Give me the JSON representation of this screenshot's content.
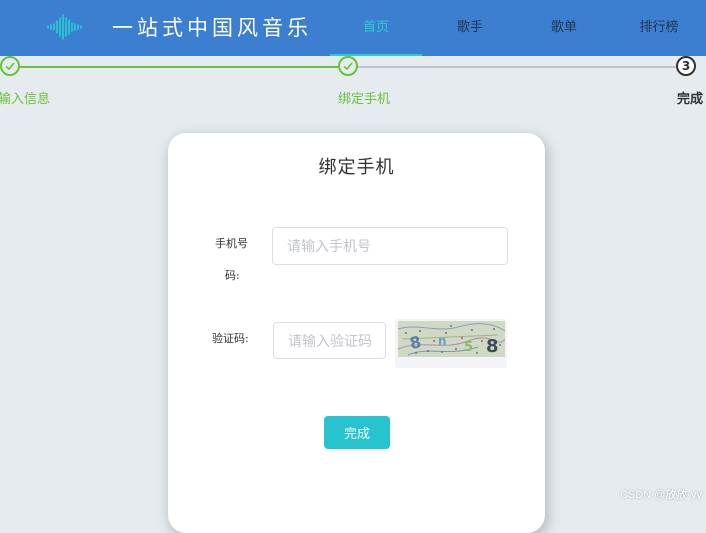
{
  "header": {
    "brand": "一站式中国风音乐",
    "logo_icon": "sound-wave-icon",
    "nav": [
      {
        "label": "首页",
        "active": true
      },
      {
        "label": "歌手",
        "active": false
      },
      {
        "label": "歌单",
        "active": false
      },
      {
        "label": "排行榜",
        "active": false
      }
    ]
  },
  "steps": [
    {
      "label": "输入信息",
      "status": "done"
    },
    {
      "label": "绑定手机",
      "status": "done"
    },
    {
      "label": "完成",
      "status": "current",
      "number": "3"
    }
  ],
  "form": {
    "title": "绑定手机",
    "phone_label_line1": "手机号",
    "phone_label_line2": "码:",
    "phone_placeholder": "请输入手机号",
    "code_label": "验证码:",
    "code_placeholder": "请输入验证码",
    "submit_label": "完成"
  },
  "watermark": "CSDN @放放-yy",
  "colors": {
    "header_bg": "#3c7fd0",
    "accent": "#27d0cf",
    "step_done": "#67c23a",
    "button": "#27c4cf"
  }
}
